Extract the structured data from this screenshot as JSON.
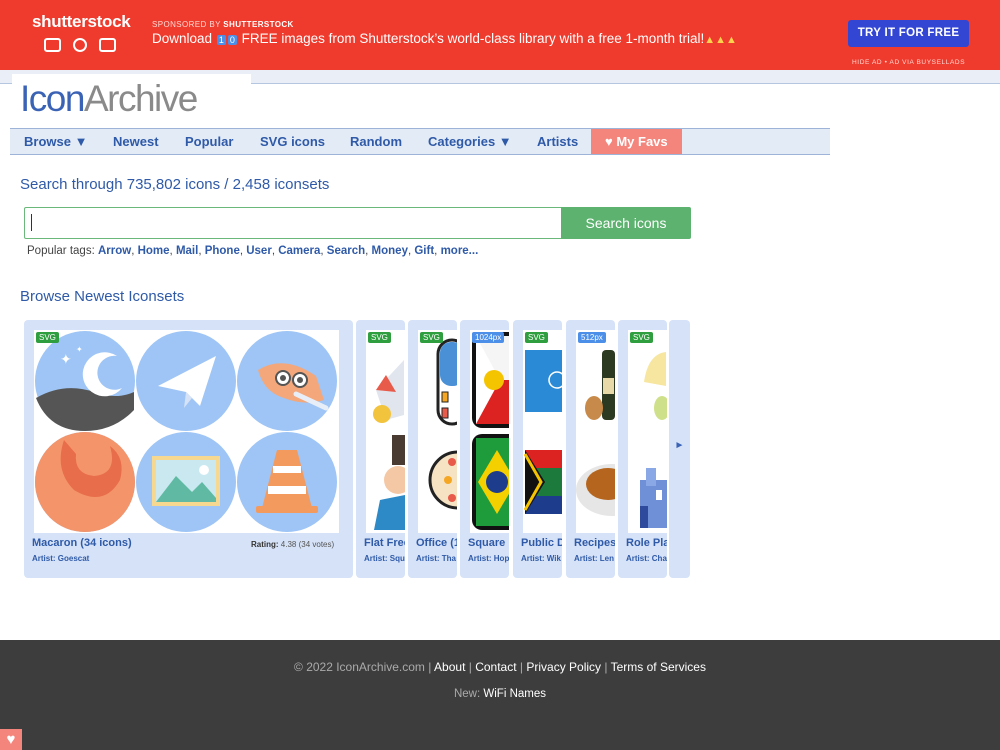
{
  "ad": {
    "brand": "shutterstock",
    "sponsored_prefix": "SPONSORED BY",
    "sponsored_name": "SHUTTERSTOCK",
    "text_before": "Download",
    "digit1": "1",
    "digit2": "0",
    "text_after": "FREE images from Shutterstock’s world-class library with a free 1-month trial!",
    "cta": "TRY IT FOR FREE",
    "hide": "HIDE AD • AD VIA BUYSELLADS",
    "icons": [
      "camera-icon",
      "music-icon",
      "play-icon"
    ]
  },
  "logo": {
    "part1": "Icon",
    "part2": "Archive"
  },
  "nav": [
    "Browse ▼",
    "Newest",
    "Popular",
    "SVG icons",
    "Random",
    "Categories ▼",
    "Artists",
    "♥ My Favs"
  ],
  "search": {
    "title": "Search through 735,802 icons / 2,458 iconsets",
    "value": "",
    "button": "Search icons"
  },
  "tags": {
    "label": "Popular tags:",
    "items": [
      "Arrow",
      "Home",
      "Mail",
      "Phone",
      "User",
      "Camera",
      "Search",
      "Money",
      "Gift",
      "more..."
    ]
  },
  "newest": {
    "title": "Browse Newest Iconsets",
    "main": {
      "badge": "SVG",
      "title": "Macaron (34 icons)",
      "artist": "Artist: Goescat",
      "rating_label": "Rating:",
      "rating_value": "4.38 (34 votes)"
    },
    "cards": [
      {
        "badge": "SVG",
        "title": "Flat Free",
        "artist": "Artist: Squ"
      },
      {
        "badge": "SVG",
        "title": "Office (1",
        "artist": "Artist: Tha"
      },
      {
        "badge": "1024px",
        "title": "Square",
        "artist": "Artist: Hop"
      },
      {
        "badge": "SVG",
        "title": "Public D",
        "artist": "Artist: Wik"
      },
      {
        "badge": "512px",
        "title": "Recipes",
        "artist": "Artist: Len"
      },
      {
        "badge": "SVG",
        "title": "Role Pla",
        "artist": "Artist: Cha"
      }
    ],
    "next": "►"
  },
  "footer": {
    "copyright": "© 2022 IconArchive.com",
    "links": [
      "About",
      "Contact",
      "Privacy Policy",
      "Terms of Services"
    ],
    "new_label": "New:",
    "new_link": "WiFi Names"
  },
  "colors": {
    "ad_red": "#ef3b2d",
    "link_blue": "#2f5aa8",
    "search_green": "#5cb26e",
    "fav_pink": "#f4857d"
  }
}
